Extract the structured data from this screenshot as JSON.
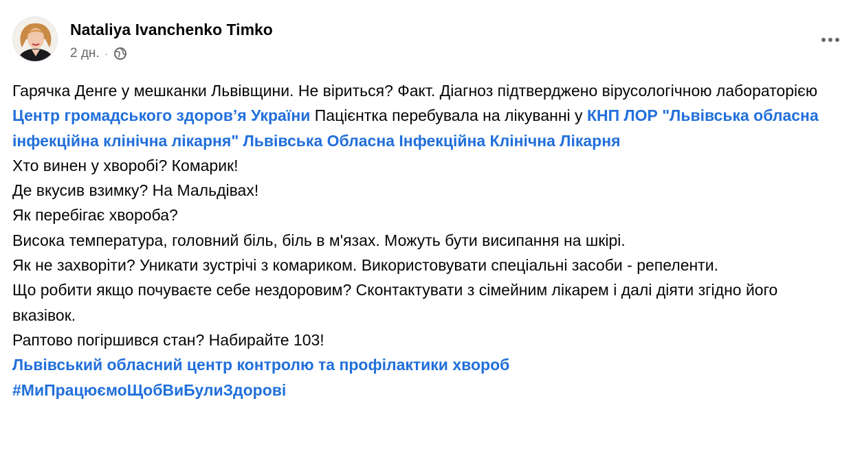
{
  "post": {
    "author": "Nataliya Ivanchenko Timko",
    "time": "2 дн.",
    "separator": "·",
    "privacy_icon": "globe-icon",
    "more_icon": "more-horizontal-icon",
    "avatar_icon": "profile-photo-avatar"
  },
  "content": {
    "p1_a": "Гарячка Денге у мешканки Львівщини. Не віриться? Факт. Діагноз підтверджено вірусологічною лабораторією ",
    "link1": "Центр громадського здоров’я України",
    "p1_b": " Пацієнтка перебувала на лікуванні у ",
    "link2": "КНП ЛОР \"Львівська обласна інфекційна клінічна лікарня\"",
    "p1_c": "  ",
    "link3": "Львівська Обласна Інфекційна Клінічна Лікарня",
    "line_q1": "Хто винен у хворобі? Комарик!",
    "line_q2": "Де вкусив взимку? На Мальдівах!",
    "line_q3": "Як перебігає хвороба?",
    "line_a3": "Висока температура, головний біль, біль в м'язах.  Можуть бути висипання на шкірі.",
    "line_q4": "Як не захворіти? Уникати зустрічі з комариком. Використовувати спеціальні засоби - репеленти.",
    "line_q5": "Що робити якщо почуваєте себе нездоровим? Сконтактувати з сімейним лікарем і далі діяти згідно його вказівок.",
    "line_q6": "Раптово погіршився стан? Набирайте 103!",
    "link4": "Львівський обласний центр контролю та профілактики хвороб",
    "hashtag": "#МиПрацюємоЩобВиБулиЗдорові"
  },
  "colors": {
    "link": "#216fdb",
    "secondary_text": "#65676b",
    "primary_text": "#050505"
  }
}
